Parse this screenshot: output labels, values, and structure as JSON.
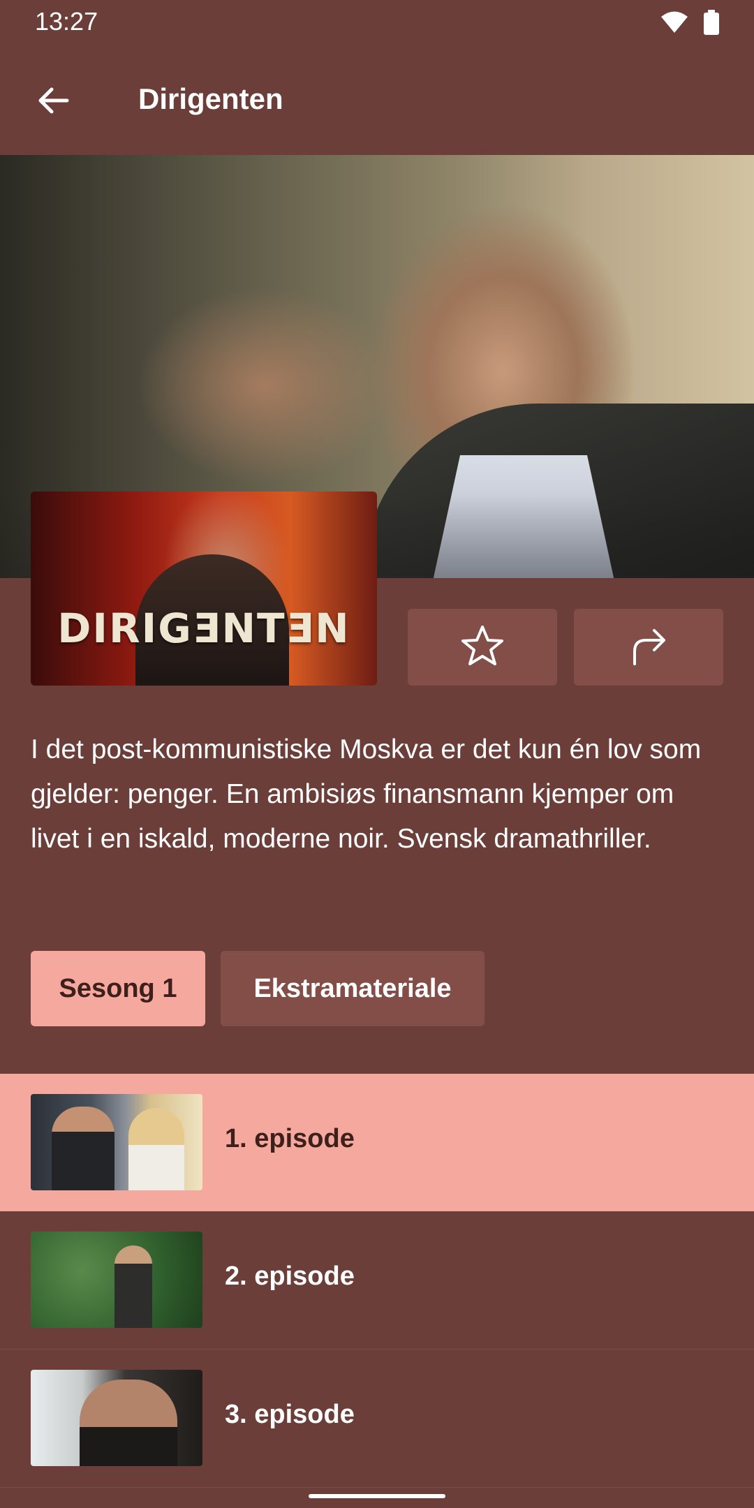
{
  "status_bar": {
    "time": "13:27",
    "icons": [
      "wifi-icon",
      "battery-icon"
    ]
  },
  "app_bar": {
    "title": "Dirigenten",
    "back_icon": "arrow-left-icon"
  },
  "hero": {
    "poster_title": "DIRIGƎNTƎN"
  },
  "actions": {
    "favorite_icon": "star-outline-icon",
    "share_icon": "share-arrow-icon"
  },
  "description": "I det post-kommunistiske Moskva er det kun én lov som gjelder: penger. En ambisiøs finansmann kjemper om livet i en iskald, moderne noir. Svensk dramathriller.",
  "tabs": [
    {
      "label": "Sesong 1",
      "active": true
    },
    {
      "label": "Ekstramateriale",
      "active": false
    }
  ],
  "episodes": [
    {
      "title": "1. episode",
      "active": true
    },
    {
      "title": "2. episode",
      "active": false
    },
    {
      "title": "3. episode",
      "active": false
    }
  ],
  "colors": {
    "background": "#6b3e39",
    "accent": "#f5a89d",
    "button": "#844e48"
  }
}
